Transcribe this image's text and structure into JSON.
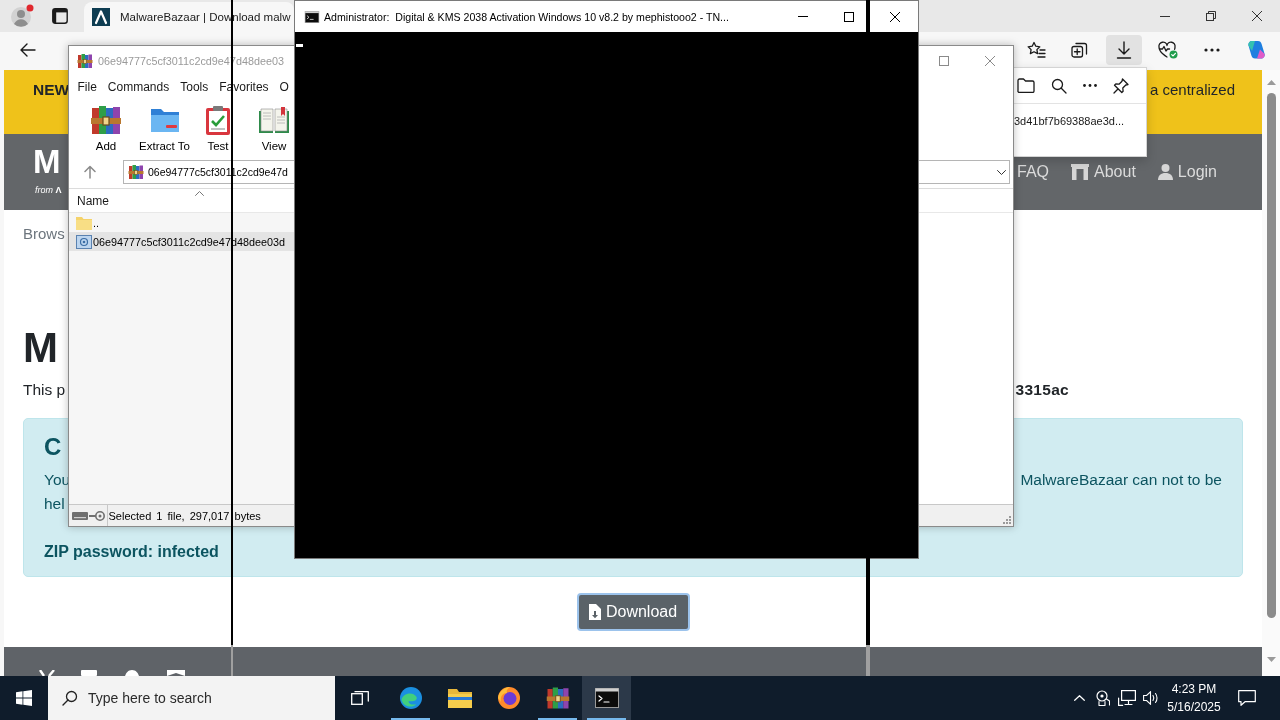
{
  "browser": {
    "tab": {
      "title": "MalwareBazaar | Download malw",
      "selected": true
    },
    "downloads_panel": {
      "open": true,
      "file": "3d41bf7b69388ae3d..."
    },
    "page": {
      "banner": {
        "lead": "NEW",
        "text": "a centralized"
      },
      "header": {
        "logo": "M",
        "logo_sub": "*from* **Λ**",
        "nav": [
          {
            "label": "FAQ"
          },
          {
            "label": "About"
          },
          {
            "label": "Login"
          }
        ]
      },
      "breadcrumb": "Brows",
      "heading": "M",
      "intro": {
        "text": "This p",
        "hash": "3315ac"
      },
      "alert": {
        "heading": "C",
        "line_1": "You",
        "line_1_end": "MalwareBazaar can not to be",
        "line_2": "hel",
        "password": "ZIP password: infected"
      },
      "download_button": "Download"
    }
  },
  "archiver": {
    "title": "06e94777c5cf3011c2cd9e47d48dee03",
    "menu": [
      "File",
      "Commands",
      "Tools",
      "Favorites",
      "O"
    ],
    "tools": [
      "Add",
      "Extract To",
      "Test",
      "View"
    ],
    "path": "06e94777c5cf3011c2cd9e47d",
    "column": "Name",
    "files": [
      {
        "kind": "folder",
        "name": "..",
        "selected": false
      },
      {
        "kind": "archive",
        "name": "06e94777c5cf3011c2cd9e47d48dee03d",
        "selected": true
      }
    ],
    "status": "Selected 1 file, 297,017 bytes"
  },
  "console": {
    "title": "Administrator:  Digital & KMS 2038 Activation Windows 10 v8.2 by mephistooo2 - TN..."
  },
  "taskbar": {
    "search": {
      "placeholder": "Type here to search"
    },
    "apps": [
      {
        "running": true,
        "active": false
      },
      {
        "running": false,
        "active": false
      },
      {
        "running": false,
        "active": false
      },
      {
        "running": true,
        "active": false
      },
      {
        "running": true,
        "active": true
      }
    ],
    "time": "4:23 PM",
    "date": "5/16/2025"
  }
}
